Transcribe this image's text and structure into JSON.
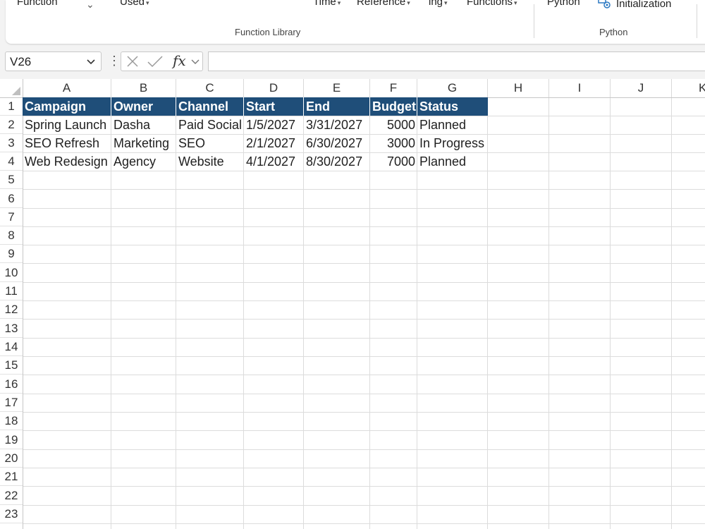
{
  "ribbon": {
    "items": [
      {
        "label": "Function",
        "caret": "⌄"
      },
      {
        "label": "Used",
        "caret": "▾"
      },
      {
        "label": "Time",
        "caret": "▾"
      },
      {
        "label": "Reference",
        "caret": "▾"
      },
      {
        "label": "ing",
        "caret": "▾"
      },
      {
        "label": "Functions",
        "caret": "▾"
      },
      {
        "label": "Python"
      },
      {
        "label": "Initialization"
      }
    ],
    "groups": [
      "Function Library",
      "Python"
    ]
  },
  "formula_bar": {
    "name_box": "V26",
    "fx_label": "fx",
    "formula": ""
  },
  "columns": [
    "A",
    "B",
    "C",
    "D",
    "E",
    "F",
    "G",
    "H",
    "I",
    "J",
    "K"
  ],
  "rows": [
    "1",
    "2",
    "3",
    "4",
    "5",
    "6",
    "7",
    "8",
    "9",
    "10",
    "11",
    "12",
    "13",
    "14",
    "15",
    "16",
    "17",
    "18",
    "19",
    "20",
    "21",
    "22",
    "23"
  ],
  "table": {
    "headers": [
      "Campaign",
      "Owner",
      "Channel",
      "Start",
      "End",
      "Budget",
      "Status"
    ],
    "rows": [
      [
        "Spring Launch",
        "Dasha",
        "Paid Social",
        "1/5/2027",
        "3/31/2027",
        "5000",
        "Planned"
      ],
      [
        "SEO Refresh",
        "Marketing",
        "SEO",
        "2/1/2027",
        "6/30/2027",
        "3000",
        "In Progress"
      ],
      [
        "Web Redesign",
        "Agency",
        "Website",
        "4/1/2027",
        "8/30/2027",
        "7000",
        "Planned"
      ]
    ]
  },
  "colors": {
    "header_fill": "#1f4e79",
    "header_text": "#ffffff"
  },
  "icons": [
    "chevron-down-icon",
    "more-vertical-icon",
    "cancel-x-icon",
    "enter-check-icon",
    "python-init-icon"
  ]
}
